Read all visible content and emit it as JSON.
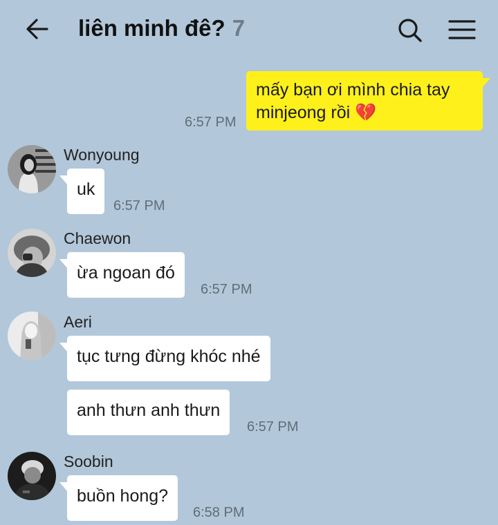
{
  "header": {
    "title": "liên minh đê?",
    "member_count": "7"
  },
  "colors": {
    "background": "#b2c7d9",
    "outgoing_bubble": "#fef01b",
    "incoming_bubble": "#ffffff"
  },
  "icons": {
    "back": "arrow-left-icon",
    "search": "search-icon",
    "menu": "hamburger-menu-icon"
  },
  "messages": {
    "m0": {
      "text_line1": "mấy bạn ơi mình chia tay",
      "text_line2": "minjeong rồi 💔",
      "time": "6:57 PM"
    },
    "m1": {
      "sender": "Wonyoung",
      "text": "uk",
      "time": "6:57 PM"
    },
    "m2": {
      "sender": "Chaewon",
      "text": "ừa ngoan đó",
      "time": "6:57 PM"
    },
    "m3": {
      "sender": "Aeri",
      "text": "tục tưng đừng khóc nhé"
    },
    "m4": {
      "text": "anh thưn anh thưn",
      "time": "6:57 PM"
    },
    "m5": {
      "sender": "Soobin",
      "text": "buồn hong?",
      "time": "6:58 PM"
    }
  }
}
